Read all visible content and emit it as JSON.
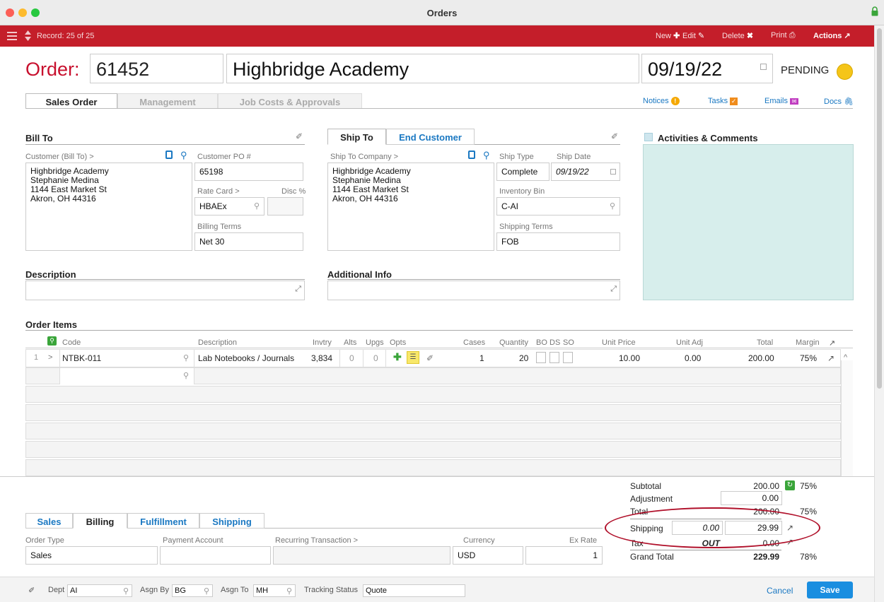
{
  "window": {
    "title": "Orders"
  },
  "toolbar": {
    "record": "Record: 25 of 25",
    "new": "New",
    "edit": "Edit",
    "delete": "Delete",
    "print": "Print",
    "actions": "Actions"
  },
  "header": {
    "order_label": "Order:",
    "order_number": "61452",
    "customer": "Highbridge Academy",
    "date": "09/19/22",
    "status": "PENDING",
    "status_color": "#f5c518"
  },
  "tabs": [
    "Sales Order",
    "Management",
    "Job Costs & Approvals"
  ],
  "top_links": {
    "notices": "Notices",
    "tasks": "Tasks",
    "emails": "Emails",
    "docs": "Docs"
  },
  "bill_to": {
    "title": "Bill To",
    "customer_label": "Customer (Bill To) >",
    "address": [
      "Highbridge Academy",
      "Stephanie Medina",
      "1144 East Market St",
      "Akron, OH 44316"
    ],
    "po_label": "Customer PO #",
    "po_value": "65198",
    "rate_card_label": "Rate Card >",
    "rate_card_value": "HBAEx",
    "disc_label": "Disc %",
    "billing_terms_label": "Billing Terms",
    "billing_terms_value": "Net 30"
  },
  "ship_to": {
    "tab_ship": "Ship To",
    "tab_end": "End Customer",
    "company_label": "Ship To Company >",
    "address": [
      "Highbridge Academy",
      "Stephanie Medina",
      "1144 East Market St",
      "Akron, OH 44316"
    ],
    "ship_type_label": "Ship Type",
    "ship_type_value": "Complete",
    "ship_date_label": "Ship Date",
    "ship_date_value": "09/19/22",
    "inventory_bin_label": "Inventory Bin",
    "inventory_bin_value": "C-AI",
    "shipping_terms_label": "Shipping Terms",
    "shipping_terms_value": "FOB"
  },
  "activities": {
    "title": "Activities & Comments"
  },
  "description": {
    "title": "Description"
  },
  "additional": {
    "title": "Additional Info"
  },
  "order_items": {
    "title": "Order Items",
    "columns": [
      "Code",
      "Description",
      "Invtry",
      "Alts",
      "Upgs",
      "Opts",
      "Cases",
      "Quantity",
      "BO",
      "DS",
      "SO",
      "Unit Price",
      "Unit Adj",
      "Total",
      "Margin"
    ],
    "rows": [
      {
        "num": "1",
        "code": "NTBK-011",
        "description": "Lab Notebooks / Journals",
        "invtry": "3,834",
        "alts": "0",
        "upgs": "0",
        "cases": "1",
        "quantity": "20",
        "unit_price": "10.00",
        "unit_adj": "0.00",
        "total": "200.00",
        "margin": "75%"
      }
    ]
  },
  "totals": {
    "subtotal_label": "Subtotal",
    "subtotal": "200.00",
    "subtotal_margin": "75%",
    "adjustment_label": "Adjustment",
    "adjustment": "0.00",
    "total_label": "Total",
    "total": "200.00",
    "total_margin": "75%",
    "shipping_label": "Shipping",
    "shipping_cost": "0.00",
    "shipping": "29.99",
    "tax_label": "Tax",
    "tax_status": "OUT",
    "tax": "0.00",
    "grand_label": "Grand Total",
    "grand": "229.99",
    "grand_margin": "78%"
  },
  "bottom_tabs": [
    "Sales",
    "Billing",
    "Fulfillment",
    "Shipping"
  ],
  "billing": {
    "order_type_label": "Order Type",
    "order_type": "Sales",
    "payment_label": "Payment Account",
    "recurring_label": "Recurring Transaction >",
    "currency_label": "Currency",
    "currency": "USD",
    "ex_rate_label": "Ex Rate",
    "ex_rate": "1"
  },
  "footer": {
    "dept_label": "Dept",
    "dept": "AI",
    "asgn_by_label": "Asgn By",
    "asgn_by": "BG",
    "asgn_to_label": "Asgn To",
    "asgn_to": "MH",
    "tracking_label": "Tracking Status",
    "tracking": "Quote",
    "cancel": "Cancel",
    "save": "Save"
  }
}
